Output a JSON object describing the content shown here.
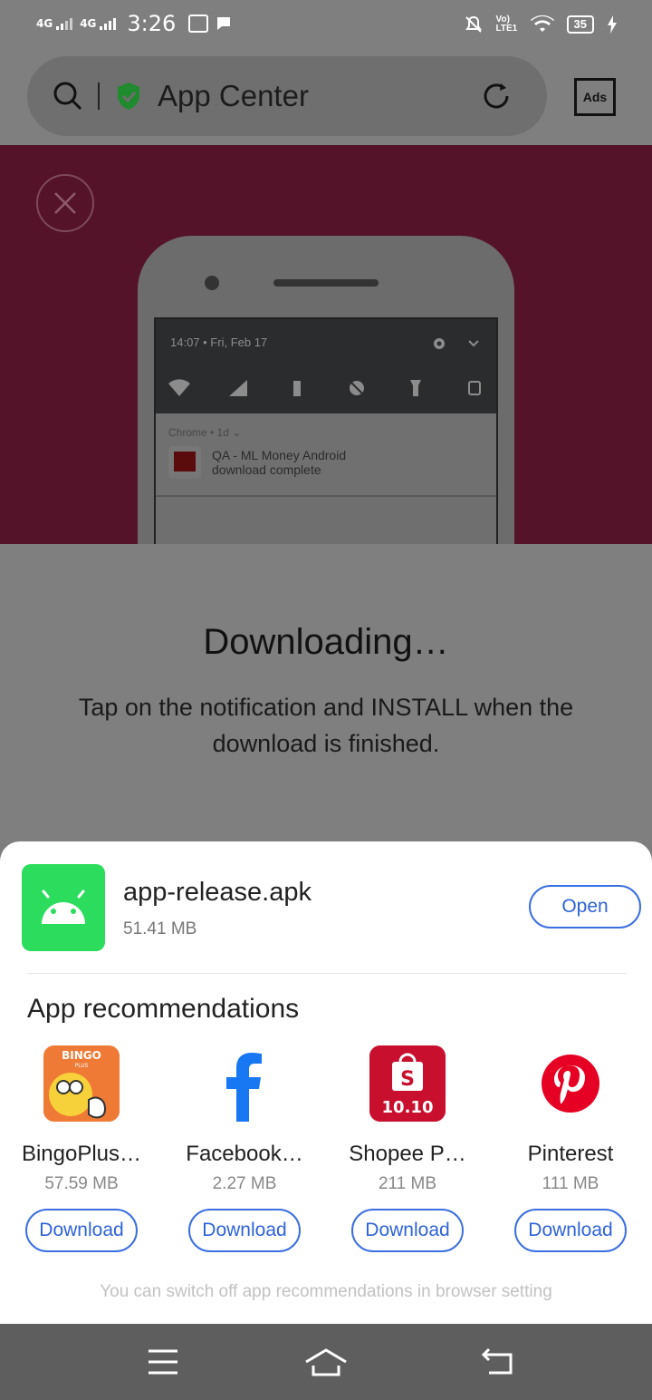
{
  "status_bar": {
    "network_1": "4G",
    "network_2": "4G",
    "time": "3:26",
    "volte": "Vo) LTE1",
    "battery": "35"
  },
  "header": {
    "title": "App Center",
    "ads_label": "Ads"
  },
  "hero": {
    "notif_time": "14:07 • Fri, Feb 17",
    "notif_source": "Chrome • 1d ⌄",
    "notif_line1": "QA - ML Money Android",
    "notif_line2": "download complete"
  },
  "download": {
    "title": "Downloading…",
    "description": "Tap on the notification and INSTALL when the download is finished."
  },
  "sheet": {
    "file_name": "app-release.apk",
    "file_size": "51.41 MB",
    "open_label": "Open",
    "rec_title": "App recommendations",
    "apps": [
      {
        "name": "BingoPlus…",
        "size": "57.59 MB",
        "button": "Download",
        "icon": "bingoplus-icon",
        "icon_text": "BINGO",
        "icon_sub": "PLUS"
      },
      {
        "name": "Facebook…",
        "size": "2.27 MB",
        "button": "Download",
        "icon": "facebook-icon"
      },
      {
        "name": "Shopee P…",
        "size": "211 MB",
        "button": "Download",
        "icon": "shopee-icon",
        "icon_text": "10.10"
      },
      {
        "name": "Pinterest",
        "size": "111 MB",
        "button": "Download",
        "icon": "pinterest-icon"
      }
    ],
    "hint": "You can switch off app recommendations in browser setting"
  },
  "colors": {
    "accent": "#2e63d8",
    "apk_green": "#2bdc5d",
    "hero": "#541329"
  }
}
